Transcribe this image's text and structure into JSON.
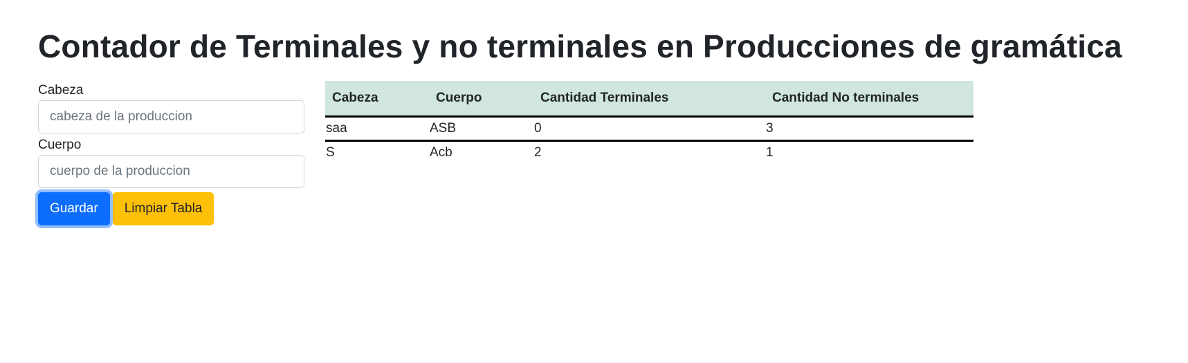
{
  "page": {
    "title": "Contador de Terminales y no terminales en Producciones de gramática"
  },
  "form": {
    "cabeza_label": "Cabeza",
    "cabeza_placeholder": "cabeza de la produccion",
    "cabeza_value": "",
    "cuerpo_label": "Cuerpo",
    "cuerpo_placeholder": "cuerpo de la produccion",
    "cuerpo_value": "",
    "save_label": "Guardar",
    "clear_label": "Limpiar Tabla"
  },
  "table": {
    "headers": [
      "Cabeza",
      "Cuerpo",
      "Cantidad Terminales",
      "Cantidad No terminales"
    ],
    "rows": [
      [
        "saa",
        "ASB",
        "0",
        "3"
      ],
      [
        "S",
        "Acb",
        "2",
        "1"
      ]
    ]
  },
  "colors": {
    "primary": "#0d6efd",
    "warning": "#ffc107",
    "table_header": "#d1e7dd"
  }
}
